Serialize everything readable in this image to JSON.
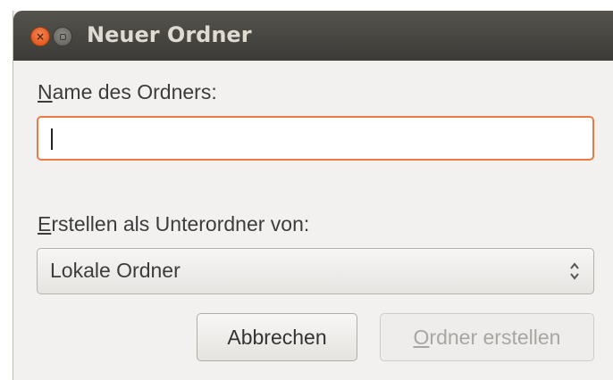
{
  "window": {
    "title": "Neuer Ordner"
  },
  "name_field": {
    "label_mnemonic": "N",
    "label_rest": "ame des Ordners:",
    "value": ""
  },
  "parent_field": {
    "label_mnemonic": "E",
    "label_rest": "rstellen als Unterordner von:",
    "selected": "Lokale Ordner"
  },
  "buttons": {
    "cancel": "Abbrechen",
    "create_mnemonic": "O",
    "create_rest": "rdner erstellen",
    "create_enabled": false
  },
  "icons": {
    "close": "close-icon",
    "minimize": "minimize-icon",
    "combo": "up-down-arrows-icon"
  },
  "colors": {
    "titlebar": "#3c3b37",
    "close_button": "#e25a1f",
    "focus_border": "#e87a45",
    "window_bg": "#f2f1f0"
  }
}
